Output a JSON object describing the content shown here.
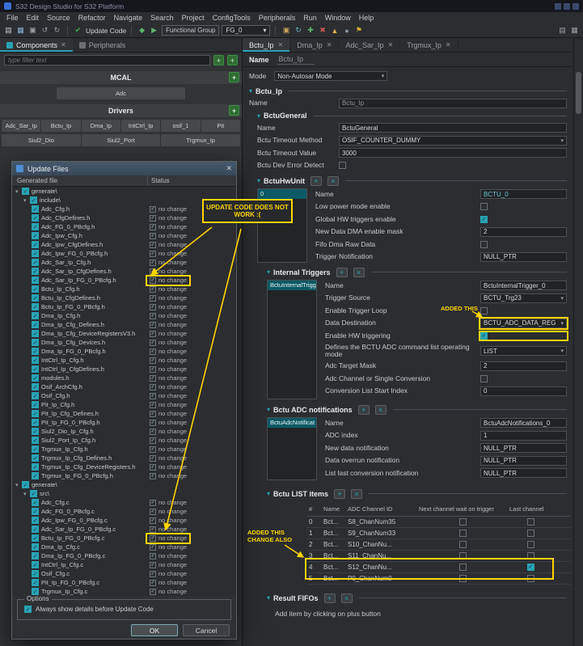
{
  "window": {
    "title": "S32 Design Studio for S32 Platform"
  },
  "menubar": [
    "File",
    "Edit",
    "Source",
    "Refactor",
    "Navigate",
    "Search",
    "Project",
    "ConfigTools",
    "Peripherals",
    "Run",
    "Window",
    "Help"
  ],
  "icons": {
    "dropdown": "▾",
    "close": "✕",
    "check": "✓",
    "expanded": "▾",
    "plus": "+",
    "cross": "×",
    "chevron": "▾"
  },
  "toolbar": {
    "update_label": "Update Code",
    "functional_group_label": "Functional Group",
    "functional_group_value": "FG_0",
    "icons_left": [
      {
        "name": "new-file-icon",
        "glyph": "▤",
        "color": "#c9ced2"
      },
      {
        "name": "save-icon",
        "glyph": "▦",
        "color": "#8ab4d8"
      },
      {
        "name": "save-all-icon",
        "glyph": "▣",
        "color": "#9aa0a4"
      },
      {
        "name": "undo-icon",
        "glyph": "↺",
        "color": "#9aa0a4"
      },
      {
        "name": "redo-icon",
        "glyph": "↻",
        "color": "#9aa0a4"
      }
    ],
    "update_icon": {
      "name": "update-code-icon",
      "glyph": "✔",
      "color": "#4caf50"
    },
    "icons_mid": [
      {
        "name": "debug-icon",
        "glyph": "◆",
        "color": "#57b46a"
      },
      {
        "name": "run-icon",
        "glyph": "▶",
        "color": "#57b46a"
      }
    ],
    "icons_right": [
      {
        "name": "pins-tool-icon",
        "glyph": "▣",
        "color": "#caa45a"
      },
      {
        "name": "clocks-tool-icon",
        "glyph": "↻",
        "color": "#6fb3c0"
      },
      {
        "name": "add-tool-icon",
        "glyph": "✚",
        "color": "#57b46a"
      },
      {
        "name": "remove-tool-icon",
        "glyph": "✖",
        "color": "#c75450"
      },
      {
        "name": "warning-icon",
        "glyph": "▲",
        "color": "#e0b050"
      },
      {
        "name": "search-icon",
        "glyph": "●",
        "color": "#8899a6"
      },
      {
        "name": "flag-icon",
        "glyph": "⚑",
        "color": "#d9b23d"
      }
    ],
    "icons_far_right": [
      {
        "name": "perspective-icon",
        "glyph": "▤",
        "color": "#9aa0a4"
      },
      {
        "name": "layout-icon",
        "glyph": "▦",
        "color": "#9aa0a4"
      }
    ]
  },
  "components": {
    "tab_components": "Components",
    "tab_peripherals": "Peripherals",
    "filter_placeholder": "type filter text",
    "mcal": "MCAL",
    "adc": "Adc",
    "drivers": "Drivers",
    "driver_row1": [
      "Adc_Sar_Ip",
      "Bctu_Ip",
      "Dma_Ip",
      "IntCtrl_Ip",
      "osif_1",
      "Pit"
    ],
    "driver_row2": [
      "Siul2_Dio",
      "Siul2_Port",
      "Trgmux_Ip"
    ]
  },
  "dialog": {
    "title": "Update Files",
    "col_file": "Generated file",
    "col_status": "Status",
    "status_text": "no change",
    "options": "Options",
    "always": "Always show details before Update Code",
    "ok": "OK",
    "cancel": "Cancel",
    "tree": [
      {
        "label": "generate\\",
        "lvl": 0,
        "folder": true
      },
      {
        "label": "include\\",
        "lvl": 1,
        "folder": true
      },
      {
        "label": "Adc_Cfg.h",
        "lvl": 2
      },
      {
        "label": "Adc_CfgDefines.h",
        "lvl": 2
      },
      {
        "label": "Adc_FG_0_PBcfg.h",
        "lvl": 2
      },
      {
        "label": "Adc_Ipw_Cfg.h",
        "lvl": 2
      },
      {
        "label": "Adc_Ipw_CfgDefines.h",
        "lvl": 2
      },
      {
        "label": "Adc_Ipw_FG_0_PBcfg.h",
        "lvl": 2
      },
      {
        "label": "Adc_Sar_Ip_Cfg.h",
        "lvl": 2
      },
      {
        "label": "Adc_Sar_Ip_CfgDefines.h",
        "lvl": 2
      },
      {
        "label": "Adc_Sar_Ip_FG_0_PBcfg.h",
        "lvl": 2,
        "hl": true
      },
      {
        "label": "Bctu_Ip_Cfg.h",
        "lvl": 2
      },
      {
        "label": "Bctu_Ip_CfgDefines.h",
        "lvl": 2
      },
      {
        "label": "Bctu_Ip_FG_0_PBcfg.h",
        "lvl": 2
      },
      {
        "label": "Dma_Ip_Cfg.h",
        "lvl": 2
      },
      {
        "label": "Dma_Ip_Cfg_Defines.h",
        "lvl": 2
      },
      {
        "label": "Dma_Ip_Cfg_DeviceRegistersV3.h",
        "lvl": 2
      },
      {
        "label": "Dma_Ip_Cfg_Devices.h",
        "lvl": 2
      },
      {
        "label": "Dma_Ip_FG_0_PBcfg.h",
        "lvl": 2
      },
      {
        "label": "IntCtrl_Ip_Cfg.h",
        "lvl": 2
      },
      {
        "label": "IntCtrl_Ip_CfgDefines.h",
        "lvl": 2
      },
      {
        "label": "modules.h",
        "lvl": 2
      },
      {
        "label": "Osif_ArchCfg.h",
        "lvl": 2
      },
      {
        "label": "Osif_Cfg.h",
        "lvl": 2
      },
      {
        "label": "Pit_Ip_Cfg.h",
        "lvl": 2
      },
      {
        "label": "Pit_Ip_Cfg_Defines.h",
        "lvl": 2
      },
      {
        "label": "Pit_Ip_FG_0_PBcfg.h",
        "lvl": 2
      },
      {
        "label": "Siul2_Dio_Ip_Cfg.h",
        "lvl": 2
      },
      {
        "label": "Siul2_Port_Ip_Cfg.h",
        "lvl": 2
      },
      {
        "label": "Trgmux_Ip_Cfg.h",
        "lvl": 2
      },
      {
        "label": "Trgmux_Ip_Cfg_Defines.h",
        "lvl": 2
      },
      {
        "label": "Trgmux_Ip_Cfg_DeviceRegisters.h",
        "lvl": 2
      },
      {
        "label": "Trgmux_Ip_FG_0_PBcfg.h",
        "lvl": 2
      },
      {
        "label": "generate\\",
        "lvl": 0,
        "folder": true
      },
      {
        "label": "src\\",
        "lvl": 1,
        "folder": true
      },
      {
        "label": "Adc_Cfg.c",
        "lvl": 2
      },
      {
        "label": "Adc_FG_0_PBcfg.c",
        "lvl": 2
      },
      {
        "label": "Adc_Ipw_FG_0_PBcfg.c",
        "lvl": 2
      },
      {
        "label": "Adc_Sar_Ip_FG_0_PBcfg.c",
        "lvl": 2
      },
      {
        "label": "Bctu_Ip_FG_0_PBcfg.c",
        "lvl": 2,
        "hl": true
      },
      {
        "label": "Dma_Ip_Cfg.c",
        "lvl": 2
      },
      {
        "label": "Dma_Ip_FG_0_PBcfg.c",
        "lvl": 2
      },
      {
        "label": "IntCtrl_Ip_Cfg.c",
        "lvl": 2
      },
      {
        "label": "Osif_Cfg.c",
        "lvl": 2
      },
      {
        "label": "Pit_Ip_FG_0_PBcfg.c",
        "lvl": 2
      },
      {
        "label": "Trgmux_Ip_Cfg.c",
        "lvl": 2
      }
    ]
  },
  "editor": {
    "tabs": [
      {
        "label": "Bctu_Ip",
        "active": true
      },
      {
        "label": "Dma_Ip",
        "active": false
      },
      {
        "label": "Adc_Sar_Ip",
        "active": false
      },
      {
        "label": "Trgmux_Ip",
        "active": false
      }
    ],
    "name_label": "Name",
    "name_value": "Bctu_Ip",
    "mode_label": "Mode",
    "mode_value": "Non-Autosar Mode",
    "sec_bctu": "Bctu_Ip",
    "top_fields": [
      {
        "label": "Name",
        "type": "input",
        "value": "Bctu_Ip",
        "disabled": true
      }
    ],
    "sec_general": "BctuGeneral",
    "general_fields": [
      {
        "label": "Name",
        "type": "input",
        "value": "BctuGeneral"
      },
      {
        "label": "Bctu Timeout Method",
        "type": "select",
        "value": "OSIF_COUNTER_DUMMY"
      },
      {
        "label": "Bctu Timeout Value",
        "type": "input",
        "value": "3000"
      },
      {
        "label": "Bctu Dev Error Detect",
        "type": "checkbox",
        "checked": false
      }
    ],
    "sec_hwunit": "BctuHwUnit",
    "hwunit_list": [
      "0"
    ],
    "hwunit_fields": [
      {
        "label": "Name",
        "type": "input",
        "value": "BCTU_0",
        "accent": true
      },
      {
        "label": "Low power mode enable",
        "type": "checkbox",
        "checked": false
      },
      {
        "label": "Global HW triggers enable",
        "type": "checkbox",
        "checked": true
      },
      {
        "label": "New Data DMA enable mask",
        "type": "input",
        "value": "2"
      },
      {
        "label": "Fifo Dma Raw Data",
        "type": "checkbox",
        "checked": false
      },
      {
        "label": "Trigger Notification",
        "type": "input",
        "value": "NULL_PTR"
      }
    ],
    "sec_internal": "Internal Triggers",
    "internal_list": [
      "BctuInternalTrigg"
    ],
    "internal_fields": [
      {
        "label": "Name",
        "type": "input",
        "value": "BctuInternalTrigger_0"
      },
      {
        "label": "Trigger Source",
        "type": "select",
        "value": "BCTU_Trg23"
      },
      {
        "label": "Enable Trigger Loop",
        "type": "checkbox",
        "checked": false
      },
      {
        "label": "Data Destination",
        "type": "select",
        "value": "BCTU_ADC_DATA_REG",
        "hl": true
      },
      {
        "label": "Enable HW triggering",
        "type": "checkbox",
        "checked": true,
        "hl": true
      },
      {
        "label": "Defines the BCTU ADC command list operating mode",
        "type": "select",
        "value": "LIST",
        "tall": true
      },
      {
        "label": "Adc Target Mask",
        "type": "input",
        "value": "2"
      },
      {
        "label": "Adc Channel or Single Conversion",
        "type": "checkbox",
        "checked": false
      },
      {
        "label": "Conversion List Start Index",
        "type": "input",
        "value": "0"
      }
    ],
    "sec_notif": "Bctu ADC notifications",
    "notif_list": [
      "BctuAdcNotificat"
    ],
    "notif_fields": [
      {
        "label": "Name",
        "type": "input",
        "value": "BctuAdcNotifications_0"
      },
      {
        "label": "ADC index",
        "type": "input",
        "value": "1"
      },
      {
        "label": "New data notification",
        "type": "input",
        "value": "NULL_PTR"
      },
      {
        "label": "Data overrun notification",
        "type": "input",
        "value": "NULL_PTR"
      },
      {
        "label": "List last conversion notification",
        "type": "input",
        "value": "NULL_PTR"
      }
    ],
    "sec_list": "Bctu LIST items",
    "list_cols": [
      "#",
      "Name",
      "ADC Channel ID",
      "Next channel wait on trigger",
      "Last channel"
    ],
    "list_rows": [
      {
        "n": "0",
        "name": "Bct...",
        "ch": "S8_ChanNum35",
        "wait": false,
        "last": false
      },
      {
        "n": "1",
        "name": "Bct...",
        "ch": "S9_ChanNum33",
        "wait": false,
        "last": false
      },
      {
        "n": "2",
        "name": "Bct...",
        "ch": "S10_ChanNu...",
        "wait": false,
        "last": false
      },
      {
        "n": "3",
        "name": "Bct...",
        "ch": "S11_ChanNu...",
        "wait": false,
        "last": false
      },
      {
        "n": "4",
        "name": "Bct...",
        "ch": "S12_ChanNu...",
        "wait": false,
        "last": true,
        "hl": true
      },
      {
        "n": "5",
        "name": "Bct...",
        "ch": "P0_ChanNum0",
        "wait": false,
        "last": false,
        "hl": true
      }
    ],
    "sec_fifo": "Result FIFOs",
    "fifo_hint": "Add item by clicking on plus button"
  },
  "annotations": {
    "note1": "UPDATE CODE DOES NOT WORK :(",
    "note2": "ADDED THIS",
    "note3": "ADDED THIS CHANGE ALSO"
  }
}
